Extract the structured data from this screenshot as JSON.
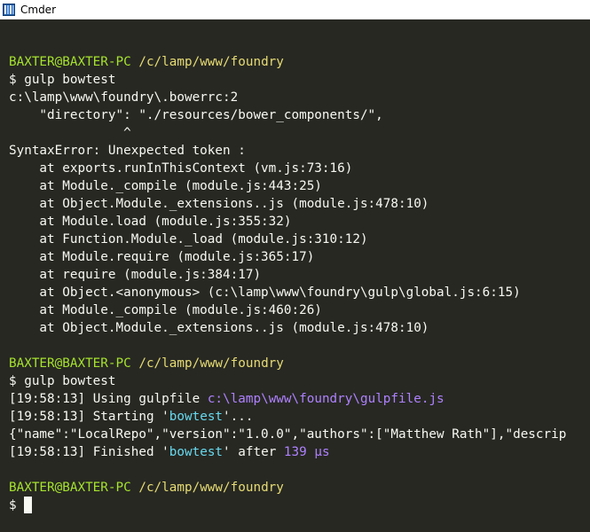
{
  "window": {
    "title": "Cmder",
    "app_icon": "cmder-icon"
  },
  "terminal": {
    "prompt_user": "BAXTER@BAXTER-PC",
    "prompt_path": "/c/lamp/www/foundry",
    "cmd1": "$ gulp bowtest",
    "err_file": "c:\\lamp\\www\\foundry\\.bowerrc:2",
    "err_line": "    \"directory\": \"./resources/bower_components/\",",
    "err_caret": "               ^",
    "err_msg": "SyntaxError: Unexpected token :",
    "stack": [
      "    at exports.runInThisContext (vm.js:73:16)",
      "    at Module._compile (module.js:443:25)",
      "    at Object.Module._extensions..js (module.js:478:10)",
      "    at Module.load (module.js:355:32)",
      "    at Function.Module._load (module.js:310:12)",
      "    at Module.require (module.js:365:17)",
      "    at require (module.js:384:17)",
      "    at Object.<anonymous> (c:\\lamp\\www\\foundry\\gulp\\global.js:6:15)",
      "    at Module._compile (module.js:460:26)",
      "    at Object.Module._extensions..js (module.js:478:10)"
    ],
    "cmd2": "$ gulp bowtest",
    "timestamp": "19:58:13",
    "using_gulpfile_label": "Using gulpfile ",
    "gulpfile_path": "c:\\lamp\\www\\foundry\\gulpfile.js",
    "starting_label": "Starting '",
    "task_name": "bowtest",
    "starting_suffix": "'...",
    "json_output": "{\"name\":\"LocalRepo\",\"version\":\"1.0.0\",\"authors\":[\"Matthew Rath\"],\"descrip",
    "finished_label": "Finished '",
    "finished_suffix": "' after ",
    "duration": "139 μs",
    "final_prompt": "$"
  }
}
